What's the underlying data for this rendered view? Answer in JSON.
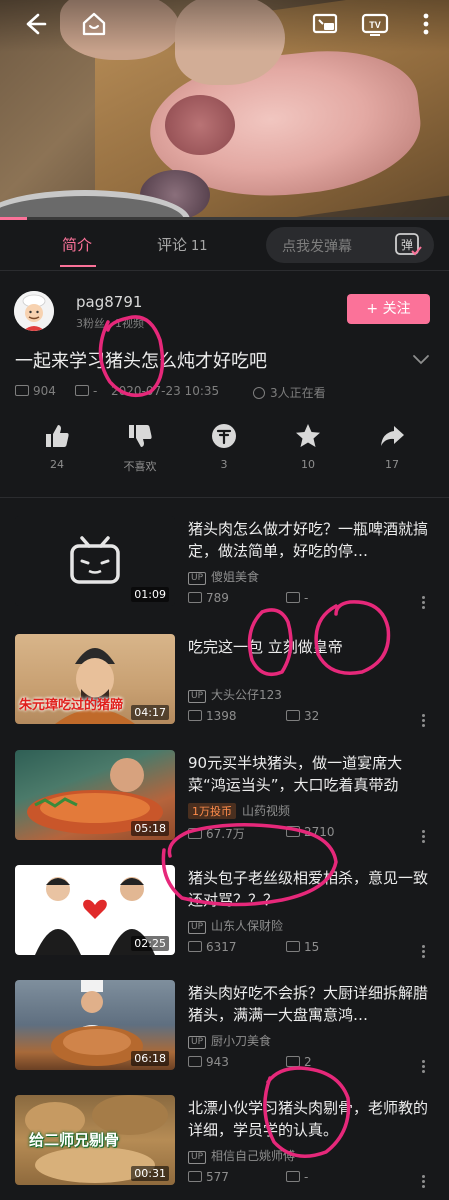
{
  "video": {
    "progress": 0.06,
    "icons": [
      "back-icon",
      "home-icon",
      "pip-icon",
      "tv-cast-icon",
      "more-vertical-icon"
    ]
  },
  "tabs": {
    "intro": "简介",
    "comments": "评论",
    "comments_count": "11",
    "danmaku_placeholder": "点我发弹幕",
    "danmaku_icon": "弹"
  },
  "uploader": {
    "name": "pag8791",
    "fans": "3粉丝",
    "videos": "1视频",
    "follow": "+ 关注"
  },
  "video_info": {
    "title": "一起来学习猪头怎么炖才好吃吧",
    "views": "904",
    "danmaku": "-",
    "date": "2020-07-23 10:35",
    "watching": "3人正在看"
  },
  "actions": [
    {
      "icon": "thumb-up-icon",
      "label": "24"
    },
    {
      "icon": "thumb-down-icon",
      "label": "不喜欢"
    },
    {
      "icon": "coin-icon",
      "label": "3"
    },
    {
      "icon": "star-icon",
      "label": "10"
    },
    {
      "icon": "share-icon",
      "label": "17"
    }
  ],
  "recommendations": [
    {
      "title": "猪头肉怎么做才好吃？一瓶啤酒就搞定，做法简单，好吃的停…",
      "up": "傻姐美食",
      "views": "789",
      "danmaku": "-",
      "duration": "01:09"
    },
    {
      "title": "吃完这一包 立刻做皇帝",
      "up": "大头公仔123",
      "views": "1398",
      "danmaku": "32",
      "duration": "04:17",
      "thumb_text": "朱元璋吃过的猪蹄"
    },
    {
      "title": "90元买半块猪头，做一道宴席大菜“鸿运当头”，大口吃着真带劲",
      "badge": "1万投币",
      "up": "山药视频",
      "views": "67.7万",
      "danmaku": "2710",
      "duration": "05:18"
    },
    {
      "title": "猪头包子老丝级相爱相杀，意见一致还对骂？？？",
      "up": "山东人保财险",
      "views": "6317",
      "danmaku": "15",
      "duration": "02:25"
    },
    {
      "title": "猪头肉好吃不会拆？大厨详细拆解腊猪头，满满一大盘寓意鸿…",
      "up": "厨小刀美食",
      "views": "943",
      "danmaku": "2",
      "duration": "06:18"
    },
    {
      "title": "北漂小伙学习猪头肉剔骨，老师教的详细，学员学的认真。",
      "up": "相信自己姚师傅",
      "views": "577",
      "danmaku": "-",
      "duration": "00:31",
      "thumb_text": "给二师兄剔骨"
    }
  ],
  "colors": {
    "accent": "#fb7299",
    "background": "#17181a",
    "annotation": "#e6287a"
  }
}
